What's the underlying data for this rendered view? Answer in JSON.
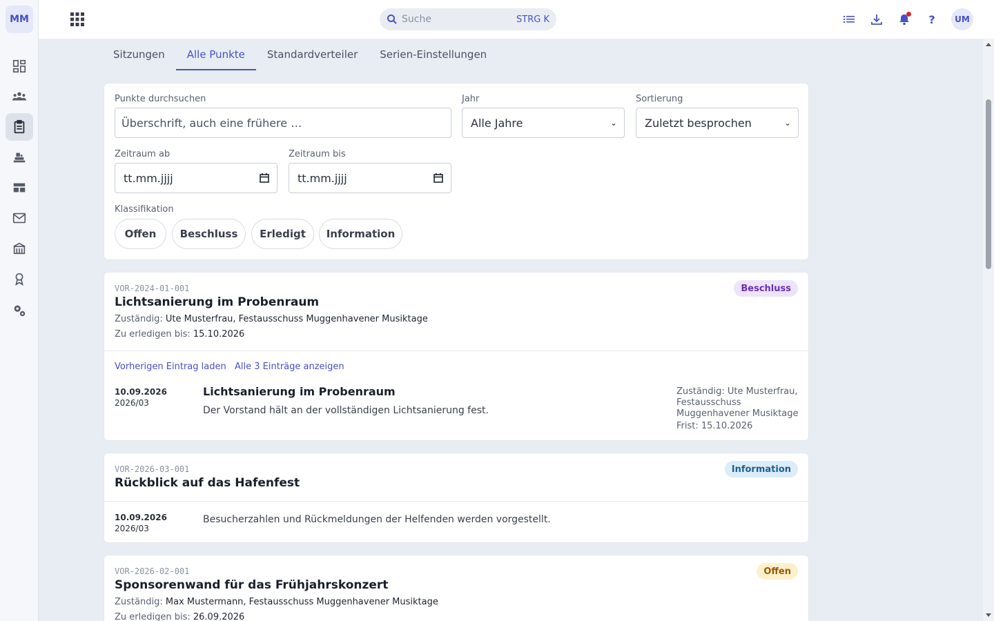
{
  "sidebar": {
    "logo": "MM",
    "items": [
      {
        "icon": "dashboard-icon"
      },
      {
        "icon": "members-icon"
      },
      {
        "icon": "clipboard-icon",
        "active": true
      },
      {
        "icon": "inventory-icon"
      },
      {
        "icon": "table-icon"
      },
      {
        "icon": "mail-icon"
      },
      {
        "icon": "building-icon"
      },
      {
        "icon": "award-icon"
      },
      {
        "icon": "settings-icon"
      }
    ]
  },
  "topbar": {
    "search_placeholder": "Suche",
    "search_shortcut": "STRG K",
    "help": "?",
    "avatar": "UM"
  },
  "tabs": [
    {
      "label": "Sitzungen"
    },
    {
      "label": "Alle Punkte",
      "active": true
    },
    {
      "label": "Standardverteiler"
    },
    {
      "label": "Serien-Einstellungen"
    }
  ],
  "filters": {
    "search_label": "Punkte durchsuchen",
    "search_placeholder": "Überschrift, auch eine frühere …",
    "year_label": "Jahr",
    "year_value": "Alle Jahre",
    "sort_label": "Sortierung",
    "sort_value": "Zuletzt besprochen",
    "from_label": "Zeitraum ab",
    "from_placeholder": "tt.mm.jjjj",
    "to_label": "Zeitraum bis",
    "to_placeholder": "tt.mm.jjjj",
    "class_label": "Klassifikation",
    "chips": [
      "Offen",
      "Beschluss",
      "Erledigt",
      "Information"
    ]
  },
  "items": [
    {
      "code": "VOR-2024-01-001",
      "title": "Lichtsanierung im Probenraum",
      "badge": "Beschluss",
      "responsible_label": "Zuständig:",
      "responsible": "Ute Musterfrau, Festausschuss Muggenhavener Musiktage",
      "due_label": "Zu erledigen bis:",
      "due": "15.10.2026",
      "link_prev": "Vorherigen Eintrag laden",
      "link_all": "Alle 3 Einträge anzeigen",
      "entry": {
        "date": "10.09.2026",
        "session": "2026/03",
        "title": "Lichtsanierung im Probenraum",
        "text": "Der Vorstand hält an der vollständigen Lichtsanierung fest.",
        "side_responsible": "Zuständig: Ute Musterfrau, Festausschuss Muggenhavener Musiktage",
        "side_deadline": "Frist: 15.10.2026"
      }
    },
    {
      "code": "VOR-2026-03-001",
      "title": "Rückblick auf das Hafenfest",
      "badge": "Information",
      "entry": {
        "date": "10.09.2026",
        "session": "2026/03",
        "text": "Besucherzahlen und Rückmeldungen der Helfenden werden vorgestellt."
      }
    },
    {
      "code": "VOR-2026-02-001",
      "title": "Sponsorenwand für das Frühjahrskonzert",
      "badge": "Offen",
      "responsible_label": "Zuständig:",
      "responsible": "Max Mustermann, Festausschuss Muggenhavener Musiktage",
      "due_label": "Zu erledigen bis:",
      "due": "26.09.2026"
    }
  ],
  "colors": {
    "accent": "#4650c9",
    "beschluss": "#6b2fb8",
    "information": "#1f5f8c",
    "offen": "#9a5a00"
  }
}
